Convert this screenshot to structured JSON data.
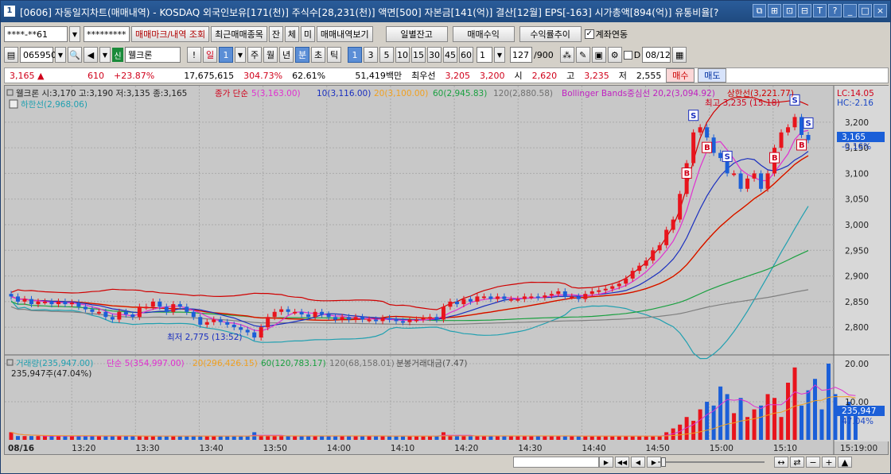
{
  "window": {
    "title": "[0606] 자동일지차트(매매내역) - KOSDAQ 외국인보유[171(천)] 주식수[28,231(천)] 액면[500] 자본금[141(억)] 결산[12월] EPS[-163] 시가총액[894(억)] 유통비율[?",
    "app_number": "1",
    "title_buttons": [
      "⧉",
      "⊞",
      "⊡",
      "⊟",
      "T",
      "?",
      "_",
      "□",
      "×"
    ]
  },
  "toolbar1": {
    "account": "****-**61",
    "password": "*********",
    "btn_mark": "매매마크/내역 조회",
    "btn_recent": "최근매매종목",
    "btn_jan": "잔",
    "btn_che": "체",
    "btn_mi": "미",
    "btn_view": "매매내역보기",
    "btn_daily": "일별잔고",
    "btn_profit": "매매수익",
    "btn_trend": "수익률추이",
    "chk_link": "계좌연동"
  },
  "toolbar2": {
    "code": "065950",
    "badge": "신",
    "name": "웰크론",
    "excl": "!",
    "period_day": "일",
    "period_num": "1",
    "periods": [
      "주",
      "월",
      "년",
      "분",
      "초",
      "틱"
    ],
    "minutes": [
      "1",
      "3",
      "5",
      "10",
      "15",
      "30",
      "45",
      "60"
    ],
    "spin": "1",
    "count": "127",
    "count_total": "/900",
    "date_check": "D",
    "date": "08/12"
  },
  "info": {
    "price": "3,165",
    "change": "610",
    "change_pct": "+23.87%",
    "volume": "17,675,615",
    "vol_pct": "304.73%",
    "ratio": "62.61%",
    "amount": "51,419백만",
    "best_ask_label": "최우선",
    "best_ask": "3,205",
    "best_bid": "3,200",
    "open_label": "시",
    "open": "2,620",
    "high_label": "고",
    "high": "3,235",
    "low_label": "저",
    "low": "2,555",
    "buy": "매수",
    "sell": "매도"
  },
  "price_panel": {
    "legend_name": "웰크론 시:3,170 고:3,190 저:3,135 종:3,165",
    "legend_ma_title": "종가 단순",
    "legend_ma5": "5(3,163.00)",
    "legend_ma10": "10(3,116.00)",
    "legend_ma20": "20(3,100.00)",
    "legend_ma60": "60(2,945.83)",
    "legend_ma120": "120(2,880.58)",
    "legend_bb": "Bollinger Bands중심선 20,2(3,094.92)",
    "legend_upper": "상한선(3,221.77)",
    "legend_lower": "하한선(2,968.06)",
    "lc": "LC:14.05",
    "hc": "HC:-2.16",
    "high_note": "최고 3,235 (15:18)",
    "low_note": "최저 2,775 (13:52)",
    "last_price": "3,165",
    "last_pct": "-0.16%",
    "y_labels": [
      "3,200",
      "3,150",
      "3,100",
      "3,050",
      "3,000",
      "2,950",
      "2,900",
      "2,850",
      "2,800"
    ]
  },
  "volume_panel": {
    "legend_vol": "거래량(235,947.00)",
    "legend_ma5": "단순 5(354,997.00)",
    "legend_ma20": "20(296,426.15)",
    "legend_ma60": "60(120,783.17)",
    "legend_ma120": "120(68,158.01)",
    "legend_amount": "분봉거래대금(7.47)",
    "sub": "235,947주(47.04%)",
    "last_vol": "235,947",
    "last_pct": "47.04%",
    "y_labels": [
      "20.00",
      "10.00"
    ]
  },
  "x_axis": {
    "labels": [
      "08/16",
      "13:20",
      "13:30",
      "13:40",
      "13:50",
      "14:00",
      "14:10",
      "14:20",
      "14:30",
      "14:40",
      "14:50",
      "15:00",
      "15:10",
      "15:19:00"
    ]
  },
  "colors": {
    "up": "#e8141c",
    "down": "#1b5fd8",
    "ma5": "#e030d0",
    "ma10": "#1a2fbf",
    "ma20": "#f0a020",
    "ma60": "#1aa040",
    "ma120": "#808080",
    "bb": "#d00000",
    "bb_lower": "#20a0b0"
  },
  "chart_data": {
    "type": "candlestick",
    "ylim": [
      2760,
      3240
    ],
    "close": [
      2860,
      2850,
      2855,
      2845,
      2850,
      2850,
      2845,
      2850,
      2845,
      2848,
      2840,
      2835,
      2830,
      2830,
      2820,
      2815,
      2830,
      2825,
      2820,
      2840,
      2840,
      2850,
      2840,
      2830,
      2845,
      2840,
      2830,
      2820,
      2805,
      2810,
      2815,
      2810,
      2805,
      2800,
      2795,
      2790,
      2780,
      2800,
      2820,
      2830,
      2835,
      2830,
      2830,
      2825,
      2820,
      2830,
      2825,
      2820,
      2815,
      2820,
      2815,
      2820,
      2815,
      2815,
      2812,
      2818,
      2815,
      2812,
      2810,
      2815,
      2815,
      2818,
      2820,
      2815,
      2840,
      2850,
      2845,
      2855,
      2850,
      2860,
      2860,
      2855,
      2860,
      2855,
      2855,
      2855,
      2860,
      2860,
      2858,
      2862,
      2865,
      2870,
      2860,
      2860,
      2855,
      2865,
      2870,
      2872,
      2875,
      2880,
      2885,
      2895,
      2910,
      2920,
      2930,
      2950,
      2960,
      2990,
      3010,
      3060,
      3120,
      3180,
      3190,
      3170,
      3140,
      3130,
      3100,
      3100,
      3070,
      3090,
      3100,
      3070,
      3100,
      3150,
      3180,
      3190,
      3210,
      3175,
      3165
    ],
    "volume": [
      2,
      1,
      1,
      1,
      1,
      1,
      1,
      1,
      1,
      1,
      1,
      1,
      1,
      1,
      1,
      1,
      1,
      1,
      1,
      1,
      1,
      1,
      1,
      1,
      1,
      1,
      1,
      1,
      1,
      1,
      1,
      1,
      1,
      1,
      1,
      1,
      2,
      1,
      1,
      1,
      1,
      1,
      1,
      1,
      1,
      1,
      1,
      1,
      1,
      1,
      1,
      1,
      1,
      1,
      1,
      1,
      1,
      1,
      1,
      1,
      1,
      1,
      1,
      1,
      2,
      1,
      1,
      1,
      1,
      1,
      1,
      1,
      1,
      1,
      1,
      1,
      1,
      1,
      1,
      1,
      1,
      1,
      1,
      1,
      1,
      1,
      1,
      1,
      1,
      1,
      1,
      1,
      1,
      1,
      1,
      1,
      1,
      2,
      3,
      4,
      6,
      5,
      8,
      10,
      9,
      14,
      12,
      7,
      11,
      6,
      8,
      9,
      12,
      11,
      6,
      15,
      19,
      9,
      13,
      16,
      8,
      20,
      12,
      9,
      10,
      7
    ],
    "xlabel": "",
    "ylabel": ""
  }
}
